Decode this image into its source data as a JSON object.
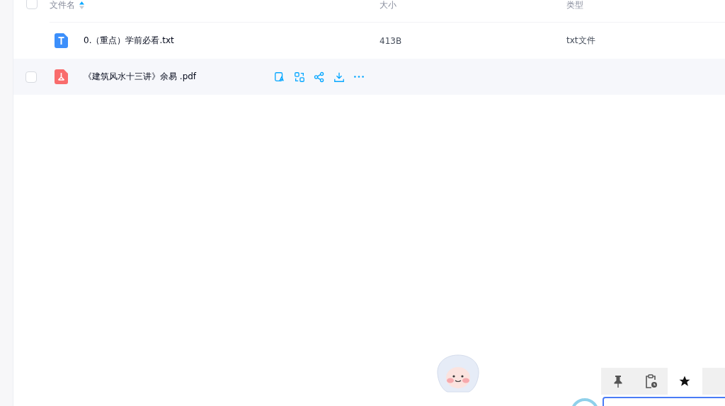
{
  "header": {
    "checked": false,
    "columns": [
      {
        "label": "文件名",
        "sorted": true
      },
      {
        "label": "大小",
        "sorted": false
      },
      {
        "label": "类型",
        "sorted": false
      }
    ]
  },
  "rows": [
    {
      "kind": "txt",
      "name": "0.（重点）学前必看.txt",
      "size": "413B",
      "type": "txt文件",
      "hovered": false,
      "checked": false
    },
    {
      "kind": "pdf",
      "name": "《建筑风水十三讲》余易 .pdf",
      "size": "",
      "type": "",
      "hovered": true,
      "checked": false
    }
  ],
  "float_toolbar": [
    {
      "kind": "pin",
      "selected": false
    },
    {
      "kind": "clipboard",
      "selected": false
    },
    {
      "kind": "star",
      "selected": true
    },
    {
      "kind": "blank",
      "selected": false
    }
  ]
}
